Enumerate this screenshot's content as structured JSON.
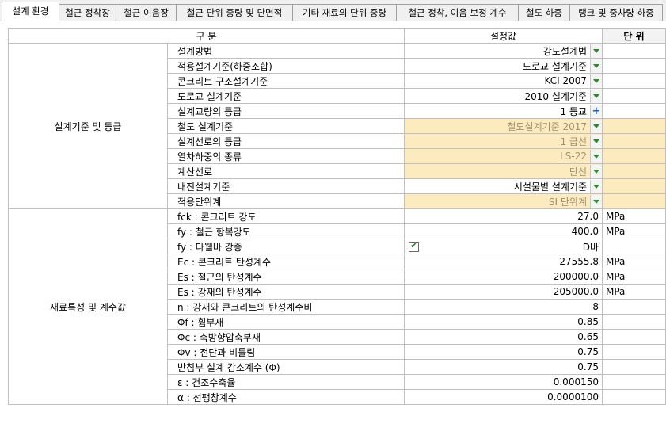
{
  "tabs": [
    {
      "label": "설계 환경",
      "active": true
    },
    {
      "label": "철근 정착장"
    },
    {
      "label": "철근 이음장"
    },
    {
      "label": "철근 단위 중량 및 단면적"
    },
    {
      "label": "기타 재료의 단위 중량"
    },
    {
      "label": "철근 정착, 이음 보정 계수"
    },
    {
      "label": "철도 하중"
    },
    {
      "label": "탱크 및 중차량 하중"
    }
  ],
  "header": {
    "category": "구 분",
    "value": "설정값",
    "unit": "단 위"
  },
  "sections": [
    {
      "category": "설계기준 및 등급",
      "rows": [
        {
          "label": "설계방법",
          "value": "강도설계법",
          "control": "dropdown"
        },
        {
          "label": "적용설계기준(하중조합)",
          "value": "도로교 설계기준",
          "control": "dropdown"
        },
        {
          "label": "콘크리트 구조설계기준",
          "value": "KCI 2007",
          "control": "dropdown"
        },
        {
          "label": "도로교 설계기준",
          "value": "2010 설계기준",
          "control": "dropdown"
        },
        {
          "label": "설계교량의 등급",
          "value": "1 등교",
          "control": "plus"
        },
        {
          "label": "철도 설계기준",
          "value": "철도설계기준 2017",
          "control": "dropdown",
          "disabled": true
        },
        {
          "label": "설계선로의 등급",
          "value": "1 급선",
          "control": "dropdown",
          "disabled": true
        },
        {
          "label": "열차하중의 종류",
          "value": "LS-22",
          "control": "dropdown",
          "disabled": true
        },
        {
          "label": "계산선로",
          "value": "단선",
          "control": "dropdown",
          "disabled": true
        },
        {
          "label": "내진설계기준",
          "value": "시설물별 설계기준",
          "control": "dropdown",
          "unitDisabled": true
        },
        {
          "label": "적용단위계",
          "value": "SI 단위계",
          "control": "dropdown",
          "disabled": true
        }
      ]
    },
    {
      "category": "재료특성 및 계수값",
      "rows": [
        {
          "label": "fck : 콘크리트 강도",
          "value": "27.0",
          "unit": "MPa"
        },
        {
          "label": "fy  : 철근 항복강도",
          "value": "400.0",
          "unit": "MPa"
        },
        {
          "label": "fy  : 다웰바 강종",
          "value": "D바",
          "control": "checkbox",
          "checked": true
        },
        {
          "label": "Ec  : 콘크리트 탄성계수",
          "value": "27555.8",
          "unit": "MPa"
        },
        {
          "label": "Es  : 철근의 탄성계수",
          "value": "200000.0",
          "unit": "MPa"
        },
        {
          "label": "Es  : 강재의 탄성계수",
          "value": "205000.0",
          "unit": "MPa"
        },
        {
          "label": "n   : 강재와 콘크리트의 탄성계수비",
          "value": "8"
        },
        {
          "label": "Φf : 휨부재",
          "value": "0.85"
        },
        {
          "label": "Φc : 축방향압축부재",
          "value": "0.65"
        },
        {
          "label": "Φv : 전단과 비틀림",
          "value": "0.75"
        },
        {
          "label": "받침부 설계 감소계수 (Φ)",
          "value": "0.75"
        },
        {
          "label": "ε  : 건조수축율",
          "value": "0.000150"
        },
        {
          "label": "α  : 선팽창계수",
          "value": "0.0000100"
        }
      ]
    }
  ],
  "colors": {
    "disabled_bg": "#fdebc0",
    "dropdown_arrow": "#2a8a2a",
    "plus": "#1b5fc8"
  }
}
